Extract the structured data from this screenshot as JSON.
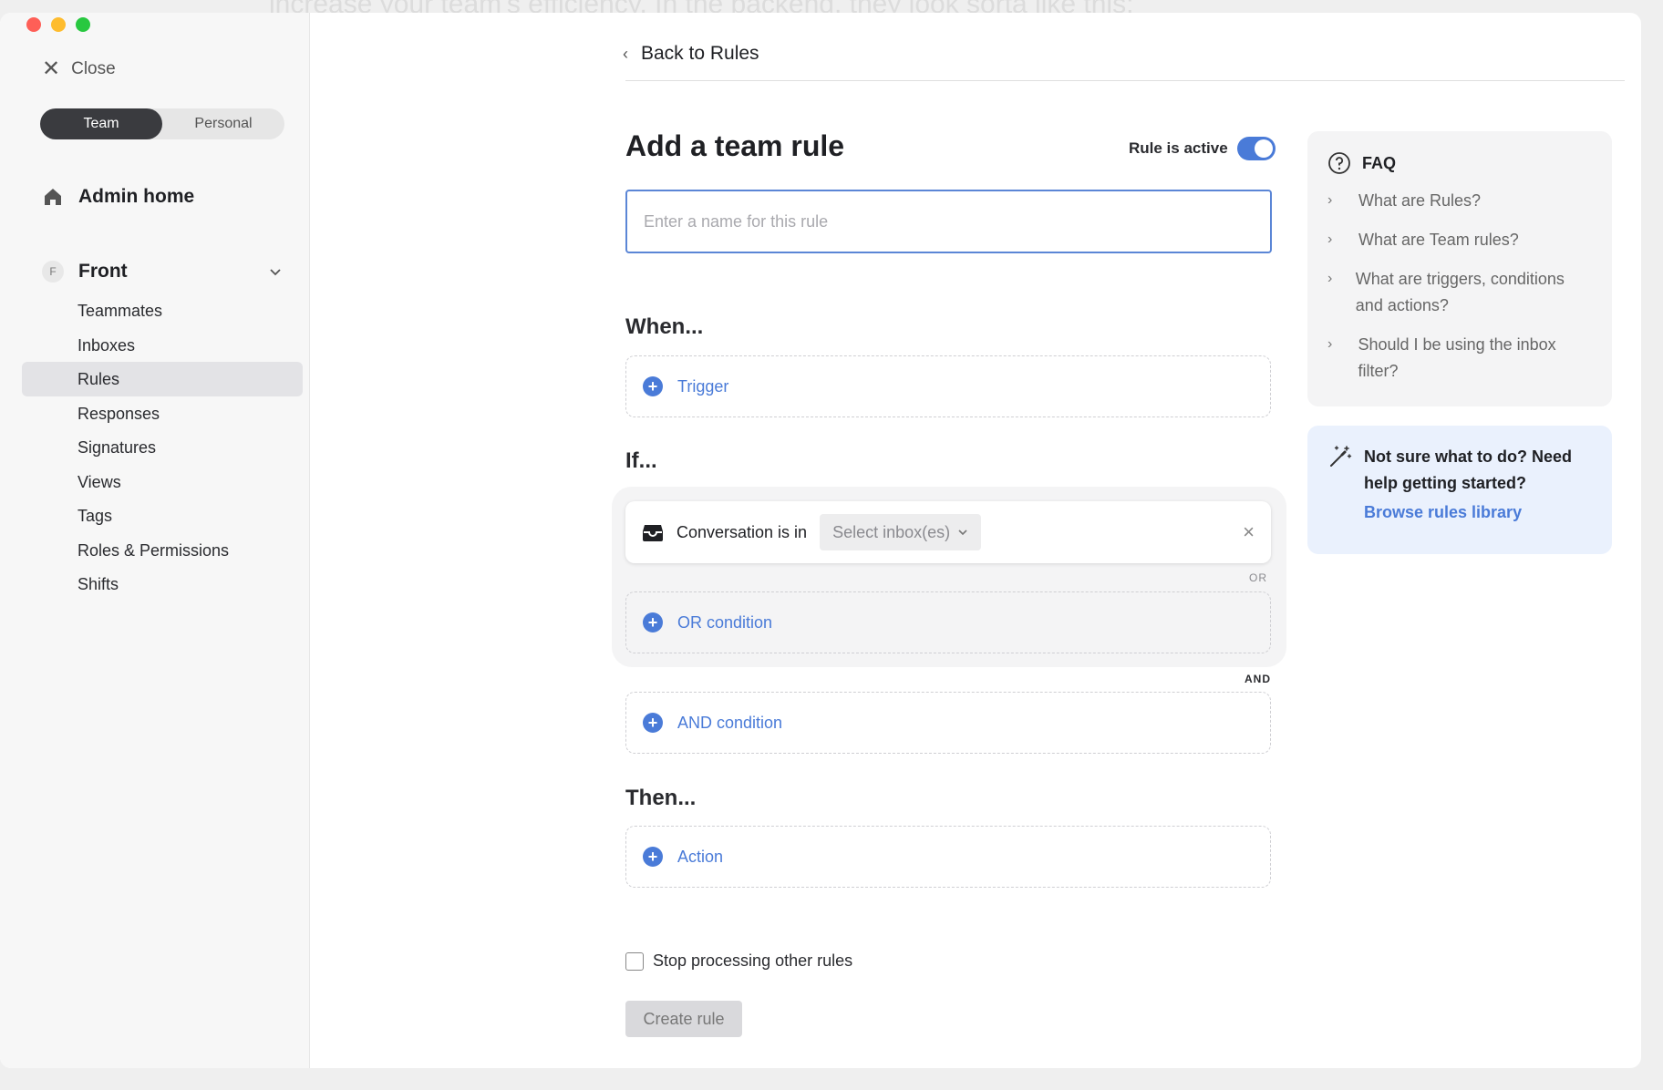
{
  "background_text": {
    "top": "increase your team's efficiency. In the backend, they look sorta like this:"
  },
  "sidebar": {
    "close_label": "Close",
    "segments": [
      "Team",
      "Personal"
    ],
    "admin_home": "Admin home",
    "workspace": {
      "badge": "F",
      "name": "Front"
    },
    "items": [
      {
        "label": "Teammates"
      },
      {
        "label": "Inboxes"
      },
      {
        "label": "Rules",
        "active": true
      },
      {
        "label": "Responses"
      },
      {
        "label": "Signatures"
      },
      {
        "label": "Views"
      },
      {
        "label": "Tags"
      },
      {
        "label": "Roles & Permissions"
      },
      {
        "label": "Shifts"
      }
    ]
  },
  "main": {
    "back_label": "Back to Rules",
    "title": "Add a team rule",
    "active_label": "Rule is active",
    "active": true,
    "name_placeholder": "Enter a name for this rule",
    "when_label": "When...",
    "trigger_label": "Trigger",
    "if_label": "If...",
    "condition": {
      "text": "Conversation is in",
      "select_placeholder": "Select inbox(es)"
    },
    "or_tag": "OR",
    "or_condition_label": "OR condition",
    "and_tag": "AND",
    "and_condition_label": "AND condition",
    "then_label": "Then...",
    "action_label": "Action",
    "stop_label": "Stop processing other rules",
    "create_label": "Create rule"
  },
  "faq": {
    "title": "FAQ",
    "items": [
      "What are Rules?",
      "What are Team rules?",
      "What are triggers, conditions and actions?",
      "Should I be using the inbox filter?"
    ]
  },
  "help": {
    "text": "Not sure what to do? Need help getting started?",
    "link": "Browse rules library"
  },
  "colors": {
    "accent": "#4a7bd8",
    "active_segment": "#3a3b3f"
  }
}
